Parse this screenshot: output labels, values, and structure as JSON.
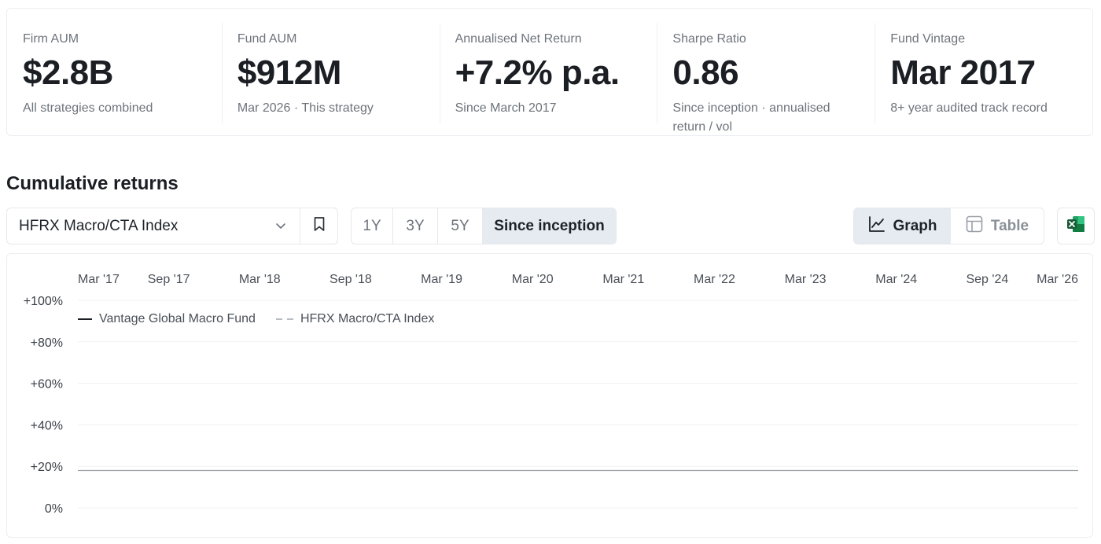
{
  "stats": [
    {
      "label": "Firm AUM",
      "value": "$2.8B",
      "sub": "All strategies combined"
    },
    {
      "label": "Fund AUM",
      "value": "$912M",
      "sub": "Mar 2026 · This strategy"
    },
    {
      "label": "Annualised Net Return",
      "value": "+7.2% p.a.",
      "sub": "Since March 2017"
    },
    {
      "label": "Sharpe Ratio",
      "value": "0.86",
      "sub": "Since inception · annualised return / vol"
    },
    {
      "label": "Fund Vintage",
      "value": "Mar 2017",
      "sub": "8+ year audited track record"
    }
  ],
  "section_title": "Cumulative returns",
  "controls": {
    "index_select": "HFRX Macro/CTA Index",
    "ranges": [
      "1Y",
      "3Y",
      "5Y",
      "Since inception"
    ],
    "active_range": "Since inception",
    "views": [
      "Graph",
      "Table"
    ],
    "active_view": "Graph"
  },
  "icons": {
    "dropdown": "chevron-down-icon",
    "bookmark": "bookmark-icon",
    "graph": "line-chart-icon",
    "table": "table-icon",
    "export": "excel-icon"
  },
  "colors": {
    "fund_series": "#1b1f24",
    "index_series": "#b7bcc2",
    "active_bg": "#e6ebf1",
    "excel_green": "#1f7a45"
  },
  "chart_data": {
    "type": "line",
    "x_ticks": [
      "Mar '17",
      "Sep '17",
      "Mar '18",
      "Sep '18",
      "Mar '19",
      "Mar '20",
      "Mar '21",
      "Mar '22",
      "Mar '23",
      "Mar '24",
      "Sep '24",
      "Mar '26"
    ],
    "y_ticks": [
      "+100%",
      "+80%",
      "+60%",
      "+40%",
      "+20%",
      "0%"
    ],
    "ylim": [
      0,
      100
    ],
    "legend_placement": "top-left",
    "grid": true,
    "series": [
      {
        "name": "Vantage Global Macro Fund",
        "style": "solid",
        "values": [
          18,
          18
        ]
      },
      {
        "name": "HFRX Macro/CTA Index",
        "style": "dashed",
        "values": []
      }
    ]
  }
}
